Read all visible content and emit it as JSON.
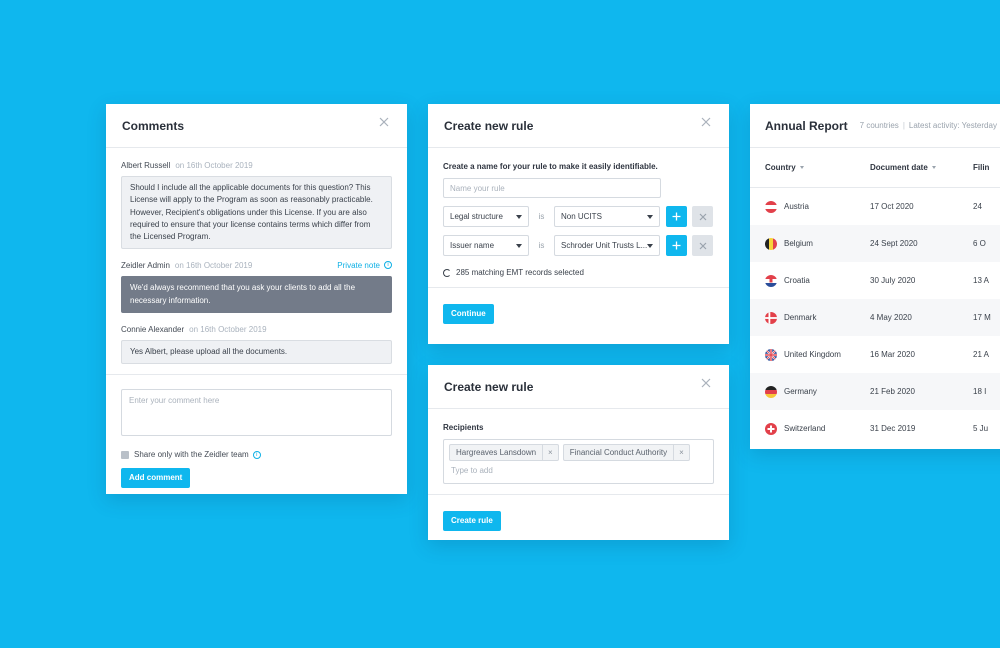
{
  "comments": {
    "title": "Comments",
    "entries": [
      {
        "author": "Albert Russell",
        "date": "on 16th October 2019",
        "text": "Should I include all the applicable documents for this question? This License will apply to the Program as soon as reasonably practicable. However, Recipient's obligations under this License. If you are also required to ensure that your license contains terms which differ from the Licensed Program."
      },
      {
        "author": "Zeidler Admin",
        "date": "on 16th October 2019",
        "badge": "Private note",
        "text": "We'd always recommend that you ask your clients to add all the necessary information."
      },
      {
        "author": "Connie Alexander",
        "date": "on 16th October 2019",
        "text": "Yes Albert, please upload all the documents."
      }
    ],
    "input_placeholder": "Enter your comment here",
    "share_label": "Share only with the Zeidler team",
    "add_button": "Add comment"
  },
  "rule1": {
    "title": "Create new rule",
    "hint": "Create a name for your rule to make it easily identifiable.",
    "name_placeholder": "Name your rule",
    "conditions": [
      {
        "field": "Legal structure",
        "operator": "is",
        "value": "Non UCITS"
      },
      {
        "field": "Issuer name",
        "operator": "is",
        "value": "Schroder Unit Trusts L..."
      }
    ],
    "match_text": "285 matching EMT records selected",
    "continue_button": "Continue"
  },
  "rule2": {
    "title": "Create new rule",
    "recipients_label": "Recipients",
    "tags": [
      "Hargreaves Lansdown",
      "Financial Conduct Authority"
    ],
    "tag_placeholder": "Type to add",
    "create_button": "Create rule"
  },
  "report": {
    "title": "Annual Report",
    "countries_count": "7 countries",
    "latest_activity": "Latest activity: Yesterday",
    "columns": [
      "Country",
      "Document date",
      "Filin"
    ],
    "rows": [
      {
        "country": "Austria",
        "date": "17 Oct 2020",
        "filing": "24"
      },
      {
        "country": "Belgium",
        "date": "24 Sept 2020",
        "filing": "6 O"
      },
      {
        "country": "Croatia",
        "date": "30 July 2020",
        "filing": "13 A"
      },
      {
        "country": "Denmark",
        "date": "4 May 2020",
        "filing": "17 M"
      },
      {
        "country": "United Kingdom",
        "date": "16 Mar 2020",
        "filing": "21 A"
      },
      {
        "country": "Germany",
        "date": "21 Feb 2020",
        "filing": "18 I"
      },
      {
        "country": "Switzerland",
        "date": "31 Dec 2019",
        "filing": "5 Ju"
      }
    ]
  },
  "colors": {
    "background": "#0fb7ee",
    "accent": "#0fb7ee",
    "admin_bubble": "#737b89"
  }
}
